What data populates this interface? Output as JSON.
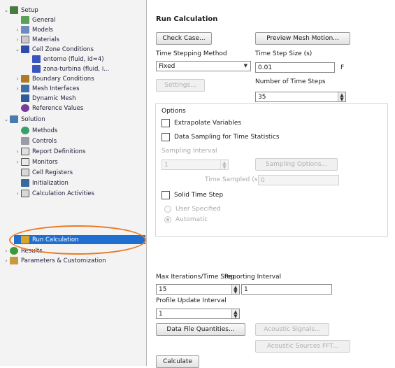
{
  "tree": {
    "items": [
      {
        "label": "Setup"
      },
      {
        "label": "General"
      },
      {
        "label": "Models"
      },
      {
        "label": "Materials"
      },
      {
        "label": "Cell Zone Conditions"
      },
      {
        "label": "entorno (fluid, id=4)"
      },
      {
        "label": "zona-turbina (fluid, i..."
      },
      {
        "label": "Boundary Conditions"
      },
      {
        "label": "Mesh Interfaces"
      },
      {
        "label": "Dynamic Mesh"
      },
      {
        "label": "Reference Values"
      },
      {
        "label": "Solution"
      },
      {
        "label": "Methods"
      },
      {
        "label": "Controls"
      },
      {
        "label": "Report Definitions"
      },
      {
        "label": "Monitors"
      },
      {
        "label": "Cell Registers"
      },
      {
        "label": "Initialization"
      },
      {
        "label": "Calculation Activities"
      },
      {
        "label": "Run Calculation"
      },
      {
        "label": "Results"
      },
      {
        "label": "Parameters & Customization"
      }
    ]
  },
  "panel": {
    "title": "Run Calculation",
    "check_case": "Check Case...",
    "preview_mesh": "Preview Mesh Motion...",
    "time_stepping_label": "Time Stepping Method",
    "time_stepping_value": "Fixed",
    "time_step_size_label": "Time Step Size (s)",
    "time_step_size_value": "0.01",
    "time_step_size_unit": "F",
    "settings_button": "Settings...",
    "num_steps_label": "Number of Time Steps",
    "num_steps_value": "35",
    "options_label": "Options",
    "extrapolate_label": "Extrapolate Variables",
    "data_sampling_label": "Data Sampling for Time Statistics",
    "sampling_interval_label": "Sampling Interval",
    "sampling_interval_value": "1",
    "sampling_options_button": "Sampling Options...",
    "time_sampled_label": "Time Sampled (s)",
    "time_sampled_value": "0",
    "solid_time_step_label": "Solid Time Step",
    "user_specified_label": "User Specified",
    "automatic_label": "Automatic",
    "max_iter_label": "Max Iterations/Time Step",
    "max_iter_value": "15",
    "reporting_interval_label": "Reporting Interval",
    "reporting_interval_value": "1",
    "profile_update_label": "Profile Update Interval",
    "profile_update_value": "1",
    "data_file_button": "Data File Quantities...",
    "acoustic_signals_button": "Acoustic Signals...",
    "acoustic_sources_button": "Acoustic Sources FFT...",
    "calculate_button": "Calculate"
  }
}
